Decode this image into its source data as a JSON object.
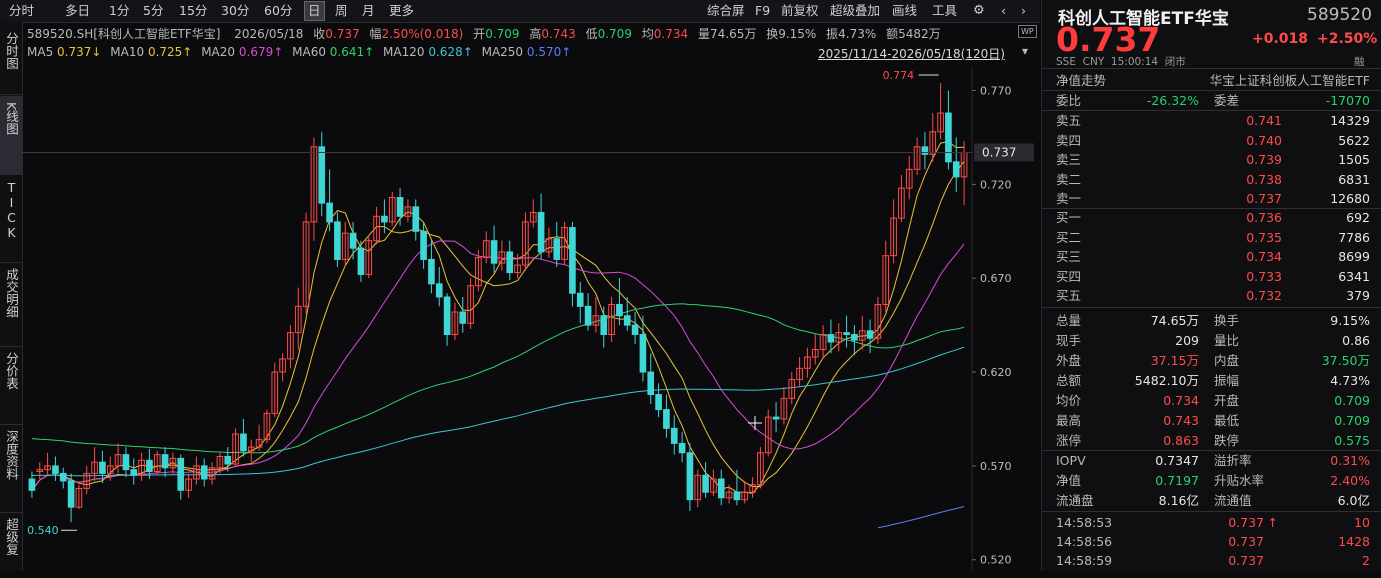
{
  "toolbar": {
    "left_items": [
      "分时",
      "多日",
      "1分",
      "5分",
      "15分",
      "30分",
      "60分",
      "日",
      "周",
      "月",
      "更多"
    ],
    "selected": "日",
    "right_items": [
      "综合屏",
      "F9",
      "前复权",
      "超级叠加",
      "画线",
      "工具"
    ]
  },
  "side_tabs": [
    {
      "label": "分时图"
    },
    {
      "label": "K线图",
      "selected": true
    },
    {
      "label": "TICK"
    },
    {
      "label": "成交明细"
    },
    {
      "label": "分价表"
    },
    {
      "label": "深度资料"
    },
    {
      "label": "超级复"
    }
  ],
  "info_bar": {
    "symbol_label": "589520.SH[科创人工智能ETF华宝]",
    "date": "2026/05/18",
    "close_label": "收",
    "close": "0.737",
    "amp_label": "幅",
    "amp": "2.50%(0.018)",
    "open_label": "开",
    "open": "0.709",
    "high_label": "高",
    "high": "0.743",
    "low_label": "低",
    "low": "0.709",
    "avg_label": "均",
    "avg": "0.734",
    "vol_label": "量",
    "vol": "74.65万",
    "turn_label": "换",
    "turn": "9.15%",
    "vib_label": "振",
    "vib": "4.73%",
    "amt_label": "额",
    "amt": "5482万",
    "wp_badge": "WP"
  },
  "ma_bar": {
    "items": [
      {
        "label": "MA5",
        "value": "0.737↓",
        "color": "#e8c23a"
      },
      {
        "label": "MA10",
        "value": "0.725↑",
        "color": "#e8c23a"
      },
      {
        "label": "MA20",
        "value": "0.679↑",
        "color": "#d64cd6"
      },
      {
        "label": "MA60",
        "value": "0.641↑",
        "color": "#2fd36b"
      },
      {
        "label": "MA120",
        "value": "0.628↑",
        "color": "#3fc4d6"
      },
      {
        "label": "MA250",
        "value": "0.570↑",
        "color": "#5a7cff"
      }
    ],
    "range": "2025/11/14-2026/05/18(120日)"
  },
  "chart_data": {
    "type": "candlestick",
    "y_ticks": [
      "0.770",
      "0.720",
      "0.670",
      "0.620",
      "0.570",
      "0.520"
    ],
    "ylim": [
      0.514,
      0.782
    ],
    "current_price_label": "0.737",
    "high_annotation": "0.774",
    "low_annotation": "0.540",
    "candles": [
      [
        0.563,
        0.567,
        0.557,
        0.553
      ],
      [
        0.567,
        0.572,
        0.568,
        0.563
      ],
      [
        0.568,
        0.577,
        0.57,
        0.565
      ],
      [
        0.57,
        0.575,
        0.566,
        0.562
      ],
      [
        0.566,
        0.569,
        0.562,
        0.558
      ],
      [
        0.562,
        0.566,
        0.548,
        0.54
      ],
      [
        0.548,
        0.56,
        0.558,
        0.547
      ],
      [
        0.558,
        0.57,
        0.566,
        0.555
      ],
      [
        0.566,
        0.58,
        0.572,
        0.562
      ],
      [
        0.572,
        0.578,
        0.566,
        0.561
      ],
      [
        0.566,
        0.575,
        0.57,
        0.562
      ],
      [
        0.57,
        0.582,
        0.576,
        0.566
      ],
      [
        0.576,
        0.58,
        0.568,
        0.564
      ],
      [
        0.568,
        0.574,
        0.565,
        0.56
      ],
      [
        0.565,
        0.577,
        0.573,
        0.562
      ],
      [
        0.573,
        0.579,
        0.567,
        0.563
      ],
      [
        0.567,
        0.578,
        0.576,
        0.565
      ],
      [
        0.576,
        0.58,
        0.569,
        0.564
      ],
      [
        0.569,
        0.577,
        0.574,
        0.565
      ],
      [
        0.574,
        0.576,
        0.557,
        0.552
      ],
      [
        0.557,
        0.566,
        0.563,
        0.553
      ],
      [
        0.563,
        0.575,
        0.57,
        0.56
      ],
      [
        0.57,
        0.574,
        0.563,
        0.559
      ],
      [
        0.563,
        0.572,
        0.569,
        0.56
      ],
      [
        0.569,
        0.577,
        0.575,
        0.566
      ],
      [
        0.575,
        0.58,
        0.571,
        0.567
      ],
      [
        0.571,
        0.59,
        0.587,
        0.57
      ],
      [
        0.587,
        0.595,
        0.578,
        0.575
      ],
      [
        0.578,
        0.584,
        0.58,
        0.572
      ],
      [
        0.58,
        0.592,
        0.584,
        0.578
      ],
      [
        0.584,
        0.6,
        0.598,
        0.582
      ],
      [
        0.598,
        0.625,
        0.62,
        0.596
      ],
      [
        0.62,
        0.63,
        0.627,
        0.615
      ],
      [
        0.627,
        0.645,
        0.641,
        0.622
      ],
      [
        0.641,
        0.665,
        0.655,
        0.632
      ],
      [
        0.655,
        0.705,
        0.7,
        0.651
      ],
      [
        0.7,
        0.745,
        0.74,
        0.69
      ],
      [
        0.74,
        0.748,
        0.71,
        0.703
      ],
      [
        0.71,
        0.728,
        0.7,
        0.695
      ],
      [
        0.7,
        0.705,
        0.68,
        0.676
      ],
      [
        0.68,
        0.7,
        0.694,
        0.676
      ],
      [
        0.694,
        0.7,
        0.686,
        0.68
      ],
      [
        0.686,
        0.69,
        0.672,
        0.668
      ],
      [
        0.672,
        0.693,
        0.69,
        0.67
      ],
      [
        0.69,
        0.708,
        0.703,
        0.688
      ],
      [
        0.703,
        0.712,
        0.7,
        0.694
      ],
      [
        0.7,
        0.716,
        0.713,
        0.698
      ],
      [
        0.713,
        0.718,
        0.703,
        0.698
      ],
      [
        0.703,
        0.712,
        0.708,
        0.7
      ],
      [
        0.708,
        0.712,
        0.695,
        0.69
      ],
      [
        0.695,
        0.7,
        0.68,
        0.675
      ],
      [
        0.68,
        0.69,
        0.667,
        0.662
      ],
      [
        0.667,
        0.676,
        0.66,
        0.655
      ],
      [
        0.66,
        0.662,
        0.64,
        0.634
      ],
      [
        0.64,
        0.657,
        0.652,
        0.637
      ],
      [
        0.652,
        0.66,
        0.646,
        0.641
      ],
      [
        0.646,
        0.67,
        0.666,
        0.643
      ],
      [
        0.666,
        0.685,
        0.681,
        0.663
      ],
      [
        0.681,
        0.695,
        0.69,
        0.678
      ],
      [
        0.69,
        0.698,
        0.678,
        0.673
      ],
      [
        0.678,
        0.69,
        0.684,
        0.674
      ],
      [
        0.684,
        0.69,
        0.673,
        0.669
      ],
      [
        0.673,
        0.683,
        0.677,
        0.67
      ],
      [
        0.677,
        0.705,
        0.7,
        0.674
      ],
      [
        0.7,
        0.712,
        0.705,
        0.697
      ],
      [
        0.705,
        0.715,
        0.684,
        0.68
      ],
      [
        0.684,
        0.697,
        0.691,
        0.681
      ],
      [
        0.691,
        0.7,
        0.68,
        0.676
      ],
      [
        0.68,
        0.7,
        0.697,
        0.677
      ],
      [
        0.697,
        0.7,
        0.662,
        0.655
      ],
      [
        0.662,
        0.668,
        0.655,
        0.646
      ],
      [
        0.655,
        0.662,
        0.645,
        0.642
      ],
      [
        0.645,
        0.66,
        0.65,
        0.641
      ],
      [
        0.65,
        0.655,
        0.64,
        0.633
      ],
      [
        0.64,
        0.66,
        0.656,
        0.636
      ],
      [
        0.656,
        0.67,
        0.65,
        0.645
      ],
      [
        0.65,
        0.66,
        0.645,
        0.642
      ],
      [
        0.645,
        0.652,
        0.64,
        0.635
      ],
      [
        0.64,
        0.65,
        0.62,
        0.615
      ],
      [
        0.62,
        0.63,
        0.608,
        0.603
      ],
      [
        0.608,
        0.614,
        0.6,
        0.596
      ],
      [
        0.6,
        0.608,
        0.59,
        0.585
      ],
      [
        0.59,
        0.597,
        0.582,
        0.576
      ],
      [
        0.582,
        0.588,
        0.577,
        0.572
      ],
      [
        0.577,
        0.582,
        0.552,
        0.546
      ],
      [
        0.552,
        0.568,
        0.565,
        0.548
      ],
      [
        0.565,
        0.572,
        0.556,
        0.553
      ],
      [
        0.556,
        0.568,
        0.563,
        0.554
      ],
      [
        0.563,
        0.568,
        0.553,
        0.549
      ],
      [
        0.553,
        0.56,
        0.556,
        0.55
      ],
      [
        0.556,
        0.568,
        0.552,
        0.549
      ],
      [
        0.552,
        0.562,
        0.556,
        0.55
      ],
      [
        0.556,
        0.564,
        0.56,
        0.553
      ],
      [
        0.56,
        0.58,
        0.577,
        0.558
      ],
      [
        0.577,
        0.6,
        0.596,
        0.575
      ],
      [
        0.596,
        0.604,
        0.595,
        0.588
      ],
      [
        0.595,
        0.612,
        0.606,
        0.592
      ],
      [
        0.606,
        0.62,
        0.616,
        0.603
      ],
      [
        0.616,
        0.628,
        0.622,
        0.612
      ],
      [
        0.622,
        0.633,
        0.628,
        0.617
      ],
      [
        0.628,
        0.64,
        0.632,
        0.624
      ],
      [
        0.632,
        0.645,
        0.64,
        0.627
      ],
      [
        0.64,
        0.648,
        0.636,
        0.63
      ],
      [
        0.636,
        0.646,
        0.641,
        0.631
      ],
      [
        0.641,
        0.65,
        0.64,
        0.633
      ],
      [
        0.64,
        0.645,
        0.637,
        0.629
      ],
      [
        0.637,
        0.65,
        0.642,
        0.632
      ],
      [
        0.642,
        0.648,
        0.638,
        0.63
      ],
      [
        0.638,
        0.66,
        0.656,
        0.635
      ],
      [
        0.656,
        0.69,
        0.682,
        0.652
      ],
      [
        0.682,
        0.712,
        0.702,
        0.678
      ],
      [
        0.702,
        0.725,
        0.718,
        0.7
      ],
      [
        0.718,
        0.735,
        0.728,
        0.712
      ],
      [
        0.728,
        0.745,
        0.74,
        0.725
      ],
      [
        0.74,
        0.748,
        0.736,
        0.728
      ],
      [
        0.736,
        0.758,
        0.748,
        0.732
      ],
      [
        0.748,
        0.774,
        0.758,
        0.744
      ],
      [
        0.758,
        0.77,
        0.732,
        0.728
      ],
      [
        0.732,
        0.745,
        0.724,
        0.716
      ],
      [
        0.724,
        0.743,
        0.737,
        0.709
      ]
    ],
    "ma_series": [
      {
        "name": "MA5",
        "color": "#e8c23a"
      },
      {
        "name": "MA10",
        "color": "#e8c23a"
      },
      {
        "name": "MA20",
        "color": "#d64cd6"
      },
      {
        "name": "MA60",
        "color": "#2fd36b"
      },
      {
        "name": "MA120",
        "color": "#3fc4d6"
      },
      {
        "name": "MA250",
        "color": "#5a7cff"
      }
    ],
    "up_color": "#ff4a4a",
    "down_color": "#3fd6d6"
  },
  "quote": {
    "name": "科创人工智能ETF华宝",
    "code": "589520",
    "price": "0.737",
    "change": "+0.018",
    "change_pct": "+2.50%",
    "market_line": "SSE  CNY  15:00:14  闭市",
    "tab_left": "净值走势",
    "tab_right": "华宝上证科创板人工智能ETF",
    "badge": "融",
    "webi_label": "委比",
    "webi": "-26.32%",
    "weicha_label": "委差",
    "weicha": "-17070",
    "asks": [
      {
        "label": "卖五",
        "price": "0.741",
        "vol": "14329"
      },
      {
        "label": "卖四",
        "price": "0.740",
        "vol": "5622"
      },
      {
        "label": "卖三",
        "price": "0.739",
        "vol": "1505"
      },
      {
        "label": "卖二",
        "price": "0.738",
        "vol": "6831"
      },
      {
        "label": "卖一",
        "price": "0.737",
        "vol": "12680"
      }
    ],
    "bids": [
      {
        "label": "买一",
        "price": "0.736",
        "vol": "692"
      },
      {
        "label": "买二",
        "price": "0.735",
        "vol": "7786"
      },
      {
        "label": "买三",
        "price": "0.734",
        "vol": "8699"
      },
      {
        "label": "买四",
        "price": "0.733",
        "vol": "6341"
      },
      {
        "label": "买五",
        "price": "0.732",
        "vol": "379"
      }
    ],
    "stats": [
      {
        "l1": "总量",
        "v1": "74.65万",
        "c1": "white",
        "l2": "换手",
        "v2": "9.15%",
        "c2": "white"
      },
      {
        "l1": "现手",
        "v1": "209",
        "c1": "white",
        "l2": "量比",
        "v2": "0.86",
        "c2": "white"
      },
      {
        "l1": "外盘",
        "v1": "37.15万",
        "c1": "red",
        "l2": "内盘",
        "v2": "37.50万",
        "c2": "green"
      },
      {
        "l1": "总额",
        "v1": "5482.10万",
        "c1": "white",
        "l2": "振幅",
        "v2": "4.73%",
        "c2": "white"
      },
      {
        "l1": "均价",
        "v1": "0.734",
        "c1": "red",
        "l2": "开盘",
        "v2": "0.709",
        "c2": "green"
      },
      {
        "l1": "最高",
        "v1": "0.743",
        "c1": "red",
        "l2": "最低",
        "v2": "0.709",
        "c2": "green"
      },
      {
        "l1": "涨停",
        "v1": "0.863",
        "c1": "red",
        "l2": "跌停",
        "v2": "0.575",
        "c2": "green"
      }
    ],
    "fund": [
      {
        "l1": "IOPV",
        "v1": "0.7347",
        "c1": "white",
        "l2": "溢折率",
        "v2": "0.31%",
        "c2": "red"
      },
      {
        "l1": "净值",
        "v1": "0.7197",
        "c1": "green",
        "l2": "升贴水率",
        "v2": "2.40%",
        "c2": "red"
      },
      {
        "l1": "流通盘",
        "v1": "8.16亿",
        "c1": "white",
        "l2": "流通值",
        "v2": "6.0亿",
        "c2": "white"
      }
    ],
    "ticks": [
      {
        "time": "14:58:53",
        "price": "0.737",
        "arrow": "↑",
        "vol": "10"
      },
      {
        "time": "14:58:56",
        "price": "0.737",
        "arrow": "",
        "vol": "1428"
      },
      {
        "time": "14:58:59",
        "price": "0.737",
        "arrow": "",
        "vol": "2"
      }
    ]
  }
}
